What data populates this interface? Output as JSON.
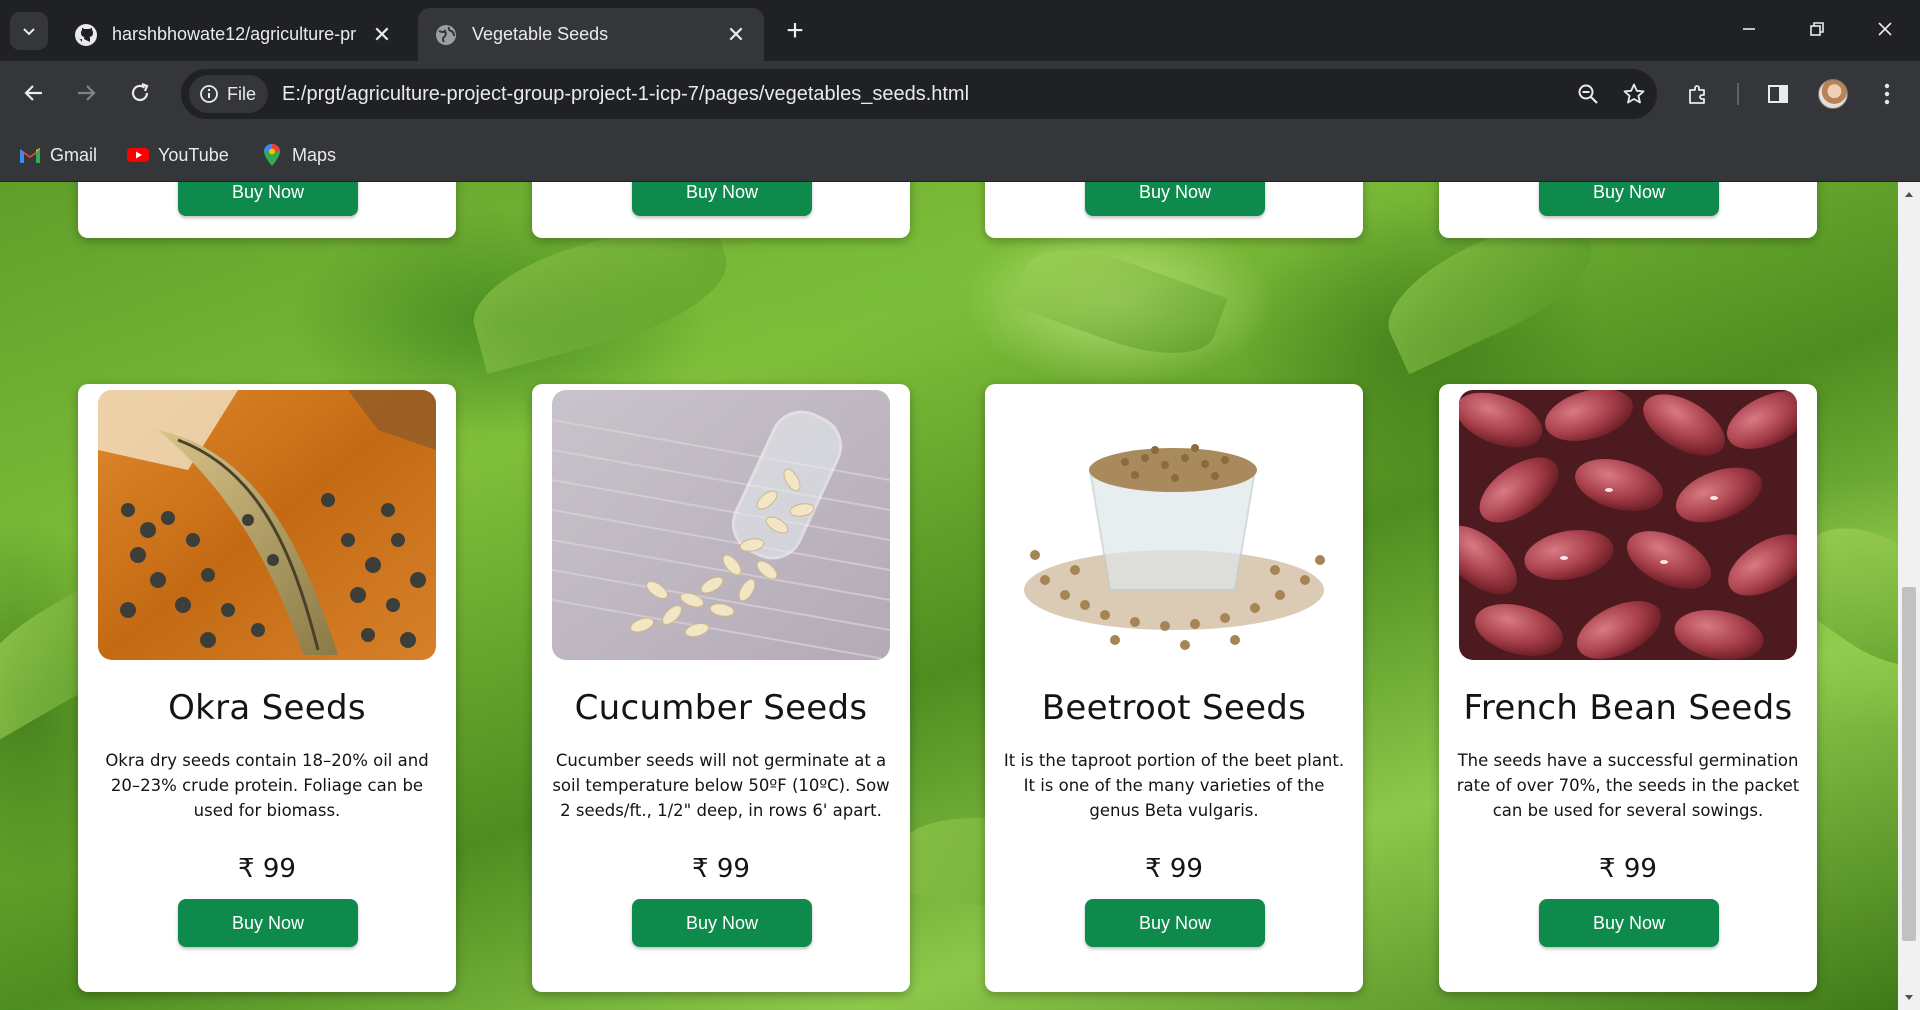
{
  "browser": {
    "tabs": [
      {
        "title": "harshbhowate12/agriculture-pr",
        "icon": "github-icon",
        "active": false
      },
      {
        "title": "Vegetable Seeds",
        "icon": "globe-icon",
        "active": true
      }
    ],
    "address_chip": "File",
    "url": "E:/prgt/agriculture-project-group-project-1-icp-7/pages/vegetables_seeds.html",
    "bookmarks": [
      {
        "label": "Gmail",
        "icon": "gmail-icon"
      },
      {
        "label": "YouTube",
        "icon": "youtube-icon"
      },
      {
        "label": "Maps",
        "icon": "maps-icon"
      }
    ]
  },
  "page": {
    "top_row": [
      {
        "buy_label": "Buy Now"
      },
      {
        "buy_label": "Buy Now"
      },
      {
        "buy_label": "Buy Now"
      },
      {
        "buy_label": "Buy Now"
      }
    ],
    "products": [
      {
        "name": "Okra Seeds",
        "description": "Okra dry seeds contain 18–20% oil and 20–23% crude protein. Foliage can be used for biomass.",
        "price": "₹ 99",
        "buy_label": "Buy Now"
      },
      {
        "name": "Cucumber Seeds",
        "description": "Cucumber seeds will not germinate at a soil temperature below 50ºF (10ºC). Sow 2 seeds/ft., 1/2\" deep, in rows 6' apart.",
        "price": "₹ 99",
        "buy_label": "Buy Now"
      },
      {
        "name": "Beetroot Seeds",
        "description": "It is the taproot portion of the beet plant. It is one of the many varieties of the genus Beta vulgaris.",
        "price": "₹ 99",
        "buy_label": "Buy Now"
      },
      {
        "name": "French Bean Seeds",
        "description": "The seeds have a successful germination rate of over 70%, the seeds in the packet can be used for several sowings.",
        "price": "₹ 99",
        "buy_label": "Buy Now"
      }
    ]
  },
  "colors": {
    "buy_button": "#0f8a4d",
    "chrome_dark": "#202124",
    "chrome_toolbar": "#35363a"
  }
}
